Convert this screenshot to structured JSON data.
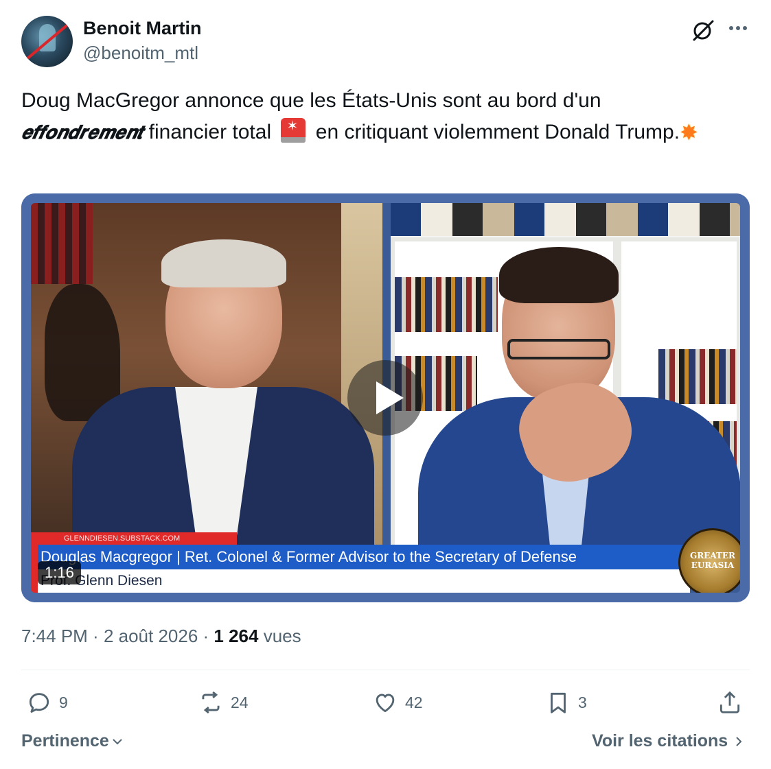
{
  "author": {
    "name": "Benoit Martin",
    "handle": "@benoitm_mtl"
  },
  "tweet": {
    "text_part1": "Doug MacGregor annonce que les États-Unis sont au bord d'un",
    "text_emphasis": "𝒆𝒇𝒇𝒐𝒏𝒅𝒓𝒆𝒎𝒆𝒏𝒕",
    "text_part2": " financier total ",
    "text_part3": " en critiquant violemment Donald Trump.",
    "emoji_1": "siren-emoji",
    "emoji_2": "collision-emoji"
  },
  "video": {
    "source_label": "GLENNDIESEN.SUBSTACK.COM",
    "lower_third_title": "Douglas Macgregor | Ret. Colonel & Former Advisor to the Secretary of Defense",
    "lower_third_subtitle": "Prof. Glenn Diesen",
    "podcast_logo_line1": "GREATER",
    "podcast_logo_line2": "EURASIA",
    "duration": "1:16"
  },
  "meta": {
    "time": "7:44 PM",
    "separator": " · ",
    "date": "2 août 2026",
    "views_count": "1 264",
    "views_label": " vues"
  },
  "actions": {
    "replies": "9",
    "reposts": "24",
    "likes": "42",
    "bookmarks": "3"
  },
  "footer": {
    "sort_label": "Pertinence",
    "quotes_label": "Voir les citations"
  },
  "colors": {
    "text": "#0f1419",
    "secondary": "#536471",
    "divider": "#eff3f4"
  }
}
